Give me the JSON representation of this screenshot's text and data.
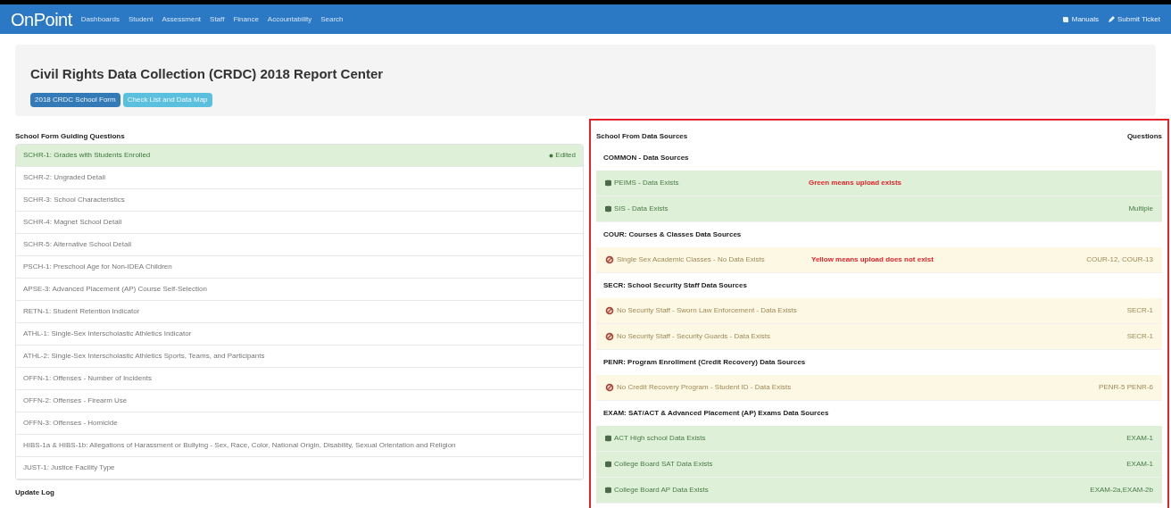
{
  "navbar": {
    "brand": "OnPoint",
    "items": [
      "Dashboards",
      "Student",
      "Assessment",
      "Staff",
      "Finance",
      "Accountability",
      "Search"
    ],
    "right_items": [
      {
        "kind": "book",
        "label": "Manuals"
      },
      {
        "kind": "pencil",
        "label": "Submit Ticket"
      }
    ]
  },
  "header": {
    "title": "Civil Rights Data Collection (CRDC) 2018 Report Center",
    "buttons": [
      {
        "label": "2018 CRDC School Form",
        "selected": true
      },
      {
        "label": "Check List and Data Map",
        "selected": false
      }
    ]
  },
  "guiding_questions": {
    "heading": "School Form Guiding Questions",
    "items": [
      {
        "label": "SCHR-1: Grades with Students Enrolled",
        "selected": true,
        "status": "Edited"
      },
      {
        "label": "SCHR-2: Ungraded Detail",
        "selected": false
      },
      {
        "label": "SCHR-3: School Characteristics",
        "selected": false
      },
      {
        "label": "SCHR-4: Magnet School Detail",
        "selected": false
      },
      {
        "label": "SCHR-5: Alternative School Detail",
        "selected": false
      },
      {
        "label": "PSCH-1: Preschool Age for Non-IDEA Children",
        "selected": false
      },
      {
        "label": "APSE-3: Advanced Placement (AP) Course Self-Selection",
        "selected": false
      },
      {
        "label": "RETN-1: Student Retention Indicator",
        "selected": false
      },
      {
        "label": "ATHL-1: Single-Sex Interscholastic Athletics Indicator",
        "selected": false
      },
      {
        "label": "ATHL-2: Single-Sex Interscholastic Athletics Sports, Teams, and Participants",
        "selected": false
      },
      {
        "label": "OFFN-1: Offenses - Number of Incidents",
        "selected": false
      },
      {
        "label": "OFFN-2: Offenses - Firearm Use",
        "selected": false
      },
      {
        "label": "OFFN-3: Offenses - Homicide",
        "selected": false
      },
      {
        "label": "HIBS-1a & HIBS-1b: Allegations of Harassment or Bullying - Sex, Race, Color, National Origin, Disability, Sexual Orientation and Religion",
        "selected": false
      },
      {
        "label": "JUST-1: Justice Facility Type",
        "selected": false
      }
    ]
  },
  "update_log": {
    "heading": "Update Log"
  },
  "data_sources": {
    "heading": "School From Data Sources",
    "questions_heading": "Questions",
    "groups": [
      {
        "title": "COMMON - Data Sources",
        "rows": [
          {
            "kind": "exists",
            "label": "PEIMS - Data Exists",
            "annotation": "Green means upload exists"
          },
          {
            "kind": "exists",
            "label": "SIS - Data Exists",
            "questions": "Multiple"
          }
        ]
      },
      {
        "title": "COUR: Courses & Classes Data Sources",
        "rows": [
          {
            "kind": "missing",
            "label": "Single Sex Academic Classes - No Data Exists",
            "annotation": "Yellow means upload does not exist",
            "questions": "COUR-12, COUR-13"
          }
        ]
      },
      {
        "title": "SECR: School Security Staff Data Sources",
        "rows": [
          {
            "kind": "missing",
            "label": "No Security Staff - Sworn Law Enforcement - Data Exists",
            "questions": "SECR-1"
          },
          {
            "kind": "missing",
            "label": "No Security Staff - Security Guards - Data Exists",
            "questions": "SECR-1"
          }
        ]
      },
      {
        "title": "PENR: Program Enrollment (Credit Recovery) Data Sources",
        "rows": [
          {
            "kind": "missing",
            "label": "No Credit Recovery Program - Student ID - Data Exists",
            "questions": "PENR-5 PENR-6"
          }
        ]
      },
      {
        "title": "EXAM: SAT/ACT & Advanced Placement (AP) Exams Data Sources",
        "rows": [
          {
            "kind": "exists",
            "label": "ACT High school Data Exists",
            "questions": "EXAM-1"
          },
          {
            "kind": "exists",
            "label": "College Board SAT Data Exists",
            "questions": "EXAM-1"
          },
          {
            "kind": "exists",
            "label": "College Board AP Data Exists",
            "questions": "EXAM-2a,EXAM-2b"
          }
        ]
      }
    ]
  }
}
